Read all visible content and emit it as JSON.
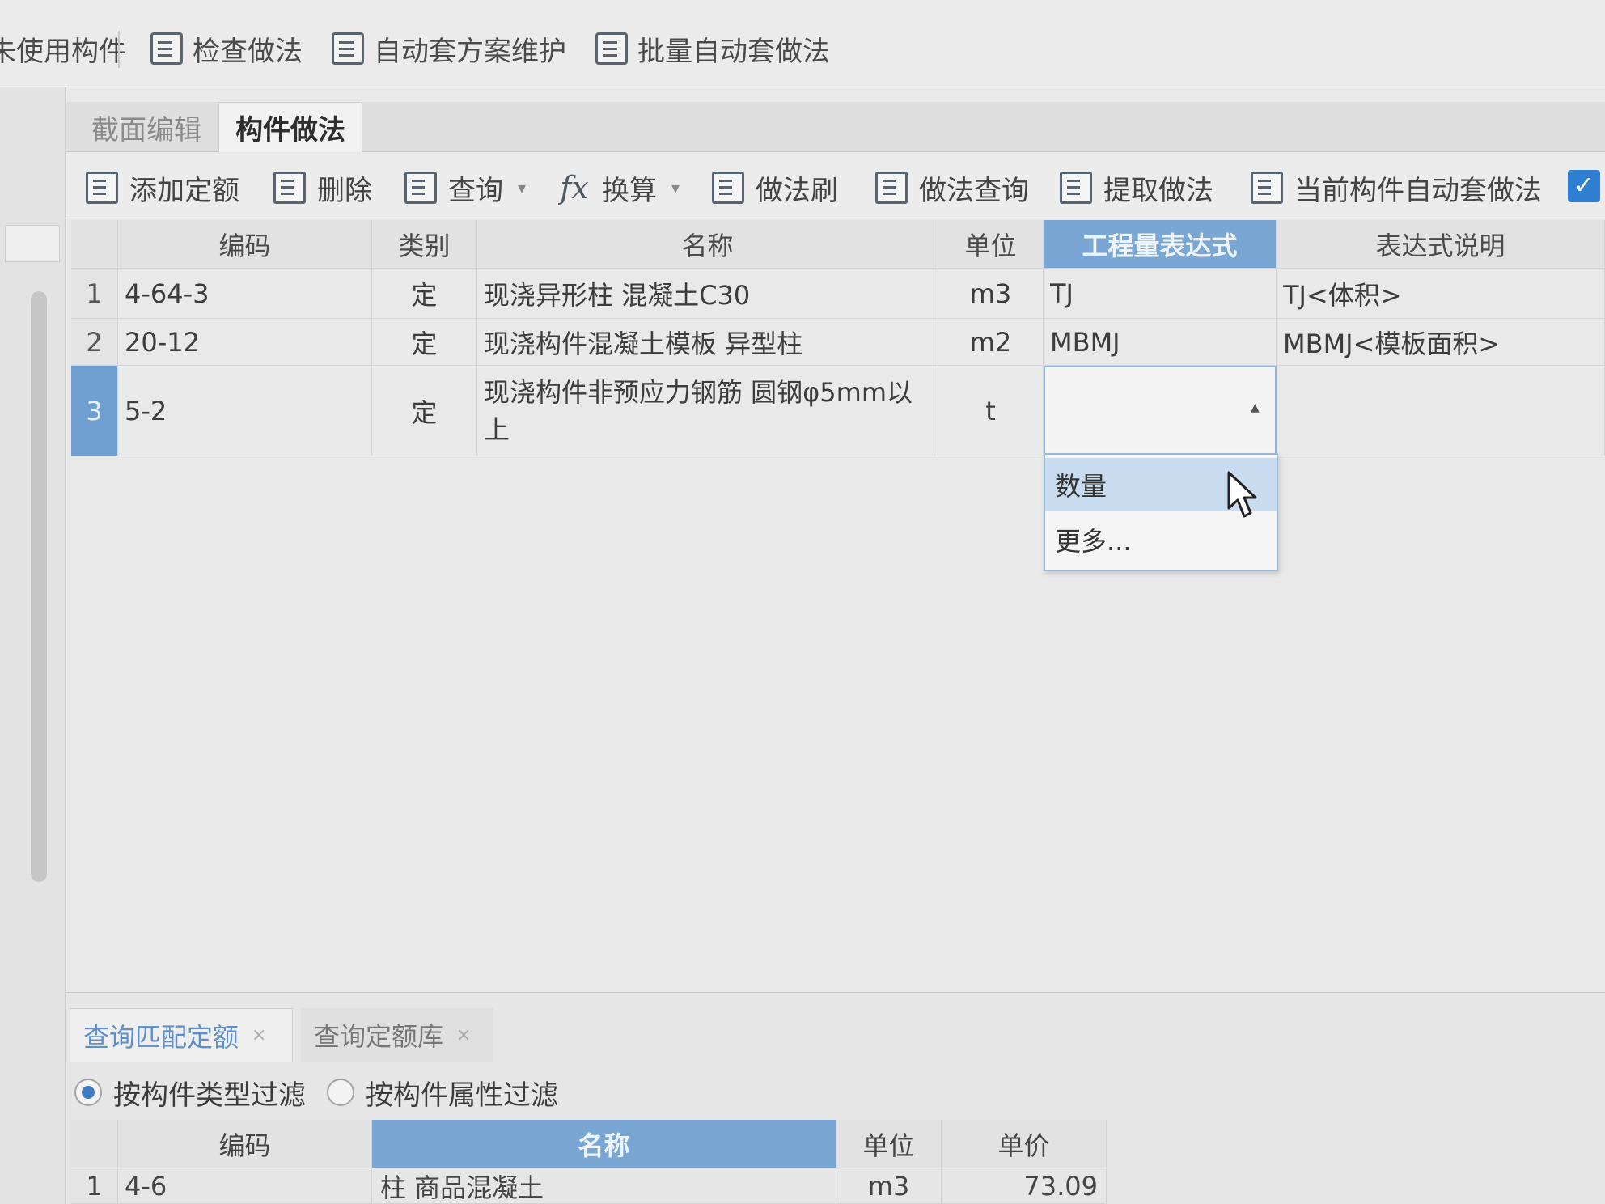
{
  "top_toolbar": {
    "items": [
      {
        "label": "未使用构件"
      },
      {
        "label": "检查做法"
      },
      {
        "label": "自动套方案维护"
      },
      {
        "label": "批量自动套做法"
      }
    ]
  },
  "tabs": [
    {
      "label": "截面编辑"
    },
    {
      "label": "构件做法"
    }
  ],
  "sub_toolbar": {
    "add_quota": "添加定额",
    "delete": "删除",
    "query": "查询",
    "convert": "换算",
    "method_brush": "做法刷",
    "method_query": "做法查询",
    "extract_method": "提取做法",
    "auto_apply_current": "当前构件自动套做法",
    "fx_symbol": "fx"
  },
  "grid": {
    "columns": [
      "编码",
      "类别",
      "名称",
      "单位",
      "工程量表达式",
      "表达式说明"
    ],
    "selected_column": "工程量表达式",
    "rows": [
      {
        "no": "1",
        "code": "4-64-3",
        "category": "定",
        "name": "现浇异形柱 混凝土C30",
        "unit": "m3",
        "expression": "TJ",
        "description": "TJ<体积>"
      },
      {
        "no": "2",
        "code": "20-12",
        "category": "定",
        "name": "现浇构件混凝土模板 异型柱",
        "unit": "m2",
        "expression": "MBMJ",
        "description": "MBMJ<模板面积>"
      },
      {
        "no": "3",
        "code": "5-2",
        "category": "定",
        "name": "现浇构件非预应力钢筋 圆钢φ5mm以上",
        "unit": "t",
        "expression": "",
        "description": ""
      }
    ],
    "dropdown": {
      "options": [
        "数量",
        "更多..."
      ],
      "highlighted": "数量"
    }
  },
  "bottom_panel": {
    "tabs": [
      {
        "label": "查询匹配定额",
        "close": "×"
      },
      {
        "label": "查询定额库",
        "close": "×"
      }
    ],
    "filters": [
      {
        "label": "按构件类型过滤",
        "checked": true
      },
      {
        "label": "按构件属性过滤",
        "checked": false
      }
    ],
    "columns": [
      "编码",
      "名称",
      "单位",
      "单价"
    ],
    "rows": [
      {
        "no": "1",
        "code": "4-6",
        "name": "柱 商品混凝土",
        "unit": "m3",
        "price": "73.09"
      }
    ]
  },
  "colors": {
    "selected_header": "#7aa6d3",
    "active_tab_text": "#5f8fc7",
    "checkbox": "#2f7fd1"
  },
  "icons": [
    "checklist-icon",
    "settings-doc-icon",
    "batch-icon",
    "add-quota-icon",
    "trash-icon",
    "search-doc-icon",
    "fx-icon",
    "brush-icon",
    "extract-icon",
    "checkbox-icon",
    "cursor-arrow-icon",
    "dropdown-caret-icon",
    "close-icon",
    "radio-icon"
  ]
}
